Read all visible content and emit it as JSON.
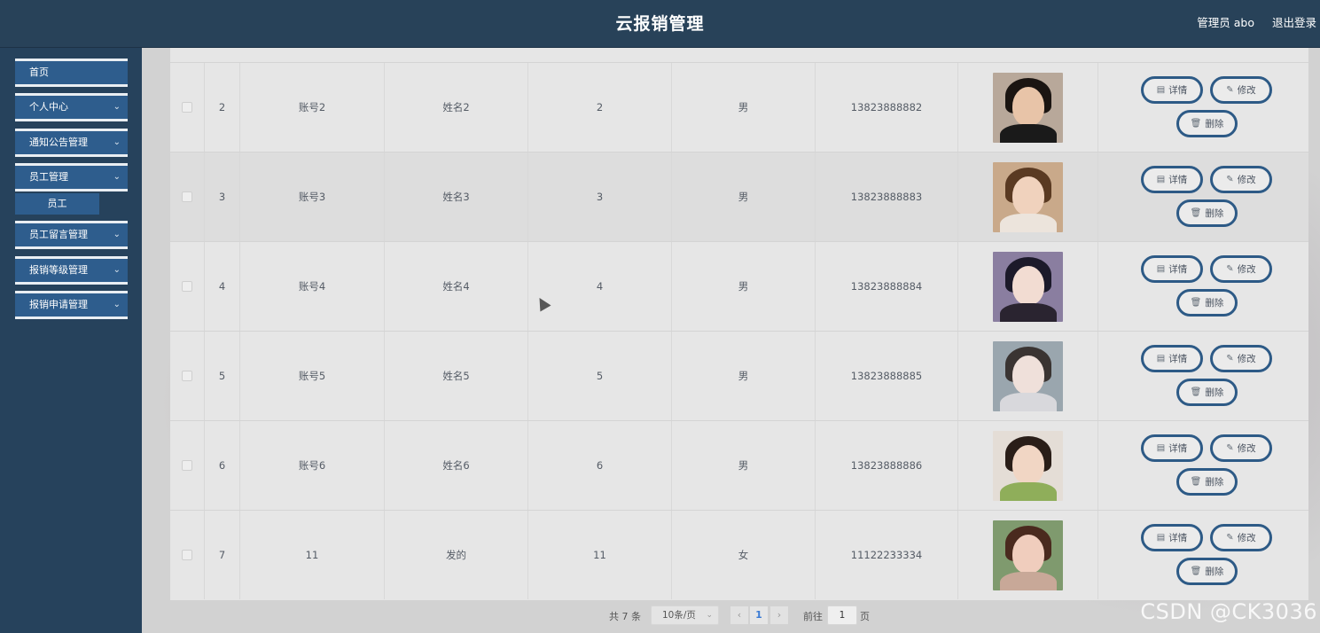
{
  "header": {
    "title": "云报销管理",
    "user": "管理员 abo",
    "logout": "退出登录"
  },
  "sidebar": {
    "items": [
      {
        "label": "首页",
        "has_arrow": false
      },
      {
        "label": "个人中心",
        "has_arrow": true
      },
      {
        "label": "通知公告管理",
        "has_arrow": true
      },
      {
        "label": "员工管理",
        "has_arrow": true
      },
      {
        "label": "员工留言管理",
        "has_arrow": true
      },
      {
        "label": "报销等级管理",
        "has_arrow": true
      },
      {
        "label": "报销申请管理",
        "has_arrow": true
      }
    ],
    "submenu": {
      "label": "员工"
    },
    "arrow_glyph": "⌄"
  },
  "table": {
    "rows": [
      {
        "index": "2",
        "account": "账号2",
        "name": "姓名2",
        "number": "2",
        "sex": "男",
        "phone": "13823888882"
      },
      {
        "index": "3",
        "account": "账号3",
        "name": "姓名3",
        "number": "3",
        "sex": "男",
        "phone": "13823888883"
      },
      {
        "index": "4",
        "account": "账号4",
        "name": "姓名4",
        "number": "4",
        "sex": "男",
        "phone": "13823888884"
      },
      {
        "index": "5",
        "account": "账号5",
        "name": "姓名5",
        "number": "5",
        "sex": "男",
        "phone": "13823888885"
      },
      {
        "index": "6",
        "account": "账号6",
        "name": "姓名6",
        "number": "6",
        "sex": "男",
        "phone": "13823888886"
      },
      {
        "index": "7",
        "account": "11",
        "name": "发的",
        "number": "11",
        "sex": "女",
        "phone": "11122233334"
      }
    ],
    "actions": {
      "detail": "详情",
      "edit": "修改",
      "delete": "删除"
    }
  },
  "pagination": {
    "total": "共 7 条",
    "page_size": "10条/页",
    "current_page": "1",
    "goto_label": "前往",
    "goto_value": "1",
    "page_suffix": "页"
  },
  "watermark": "CSDN @CK3036",
  "colors": {
    "header_bg": "#284259",
    "sidebar_bg": "#26425c",
    "menu_item_bg": "#2e5d8d",
    "button_border": "#2d5a86",
    "page_active": "#3a7bd5"
  }
}
